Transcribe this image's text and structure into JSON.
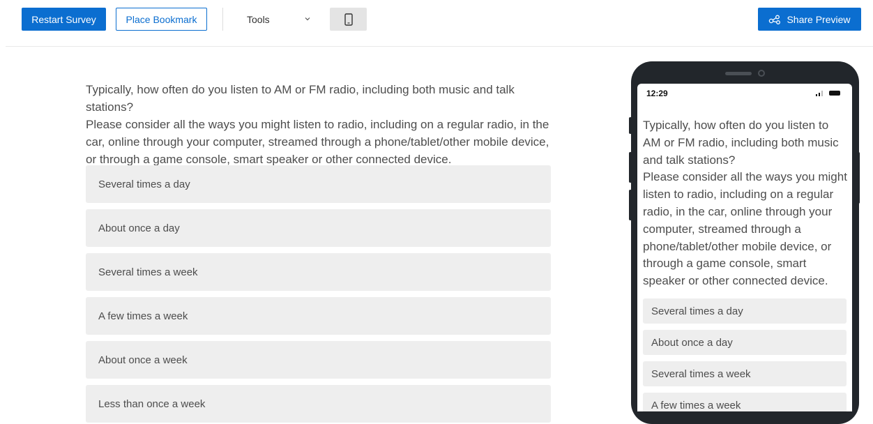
{
  "toolbar": {
    "restart_label": "Restart Survey",
    "bookmark_label": "Place Bookmark",
    "tools_label": "Tools",
    "share_label": "Share Preview",
    "accent_color": "#0b6ed0"
  },
  "question": {
    "line1": "Typically, how often do you listen to AM or FM radio, including both music and talk stations?",
    "line2": "Please consider all the ways you might listen to radio, including on a regular radio, in the car, online through your computer, streamed through a phone/tablet/other mobile device, or through a game console, smart speaker or other connected device."
  },
  "choices": [
    "Several times a day",
    "About once a day",
    "Several times a week",
    "A few times a week",
    "About once a week",
    "Less than once a week"
  ],
  "mobile": {
    "time": "12:29"
  }
}
